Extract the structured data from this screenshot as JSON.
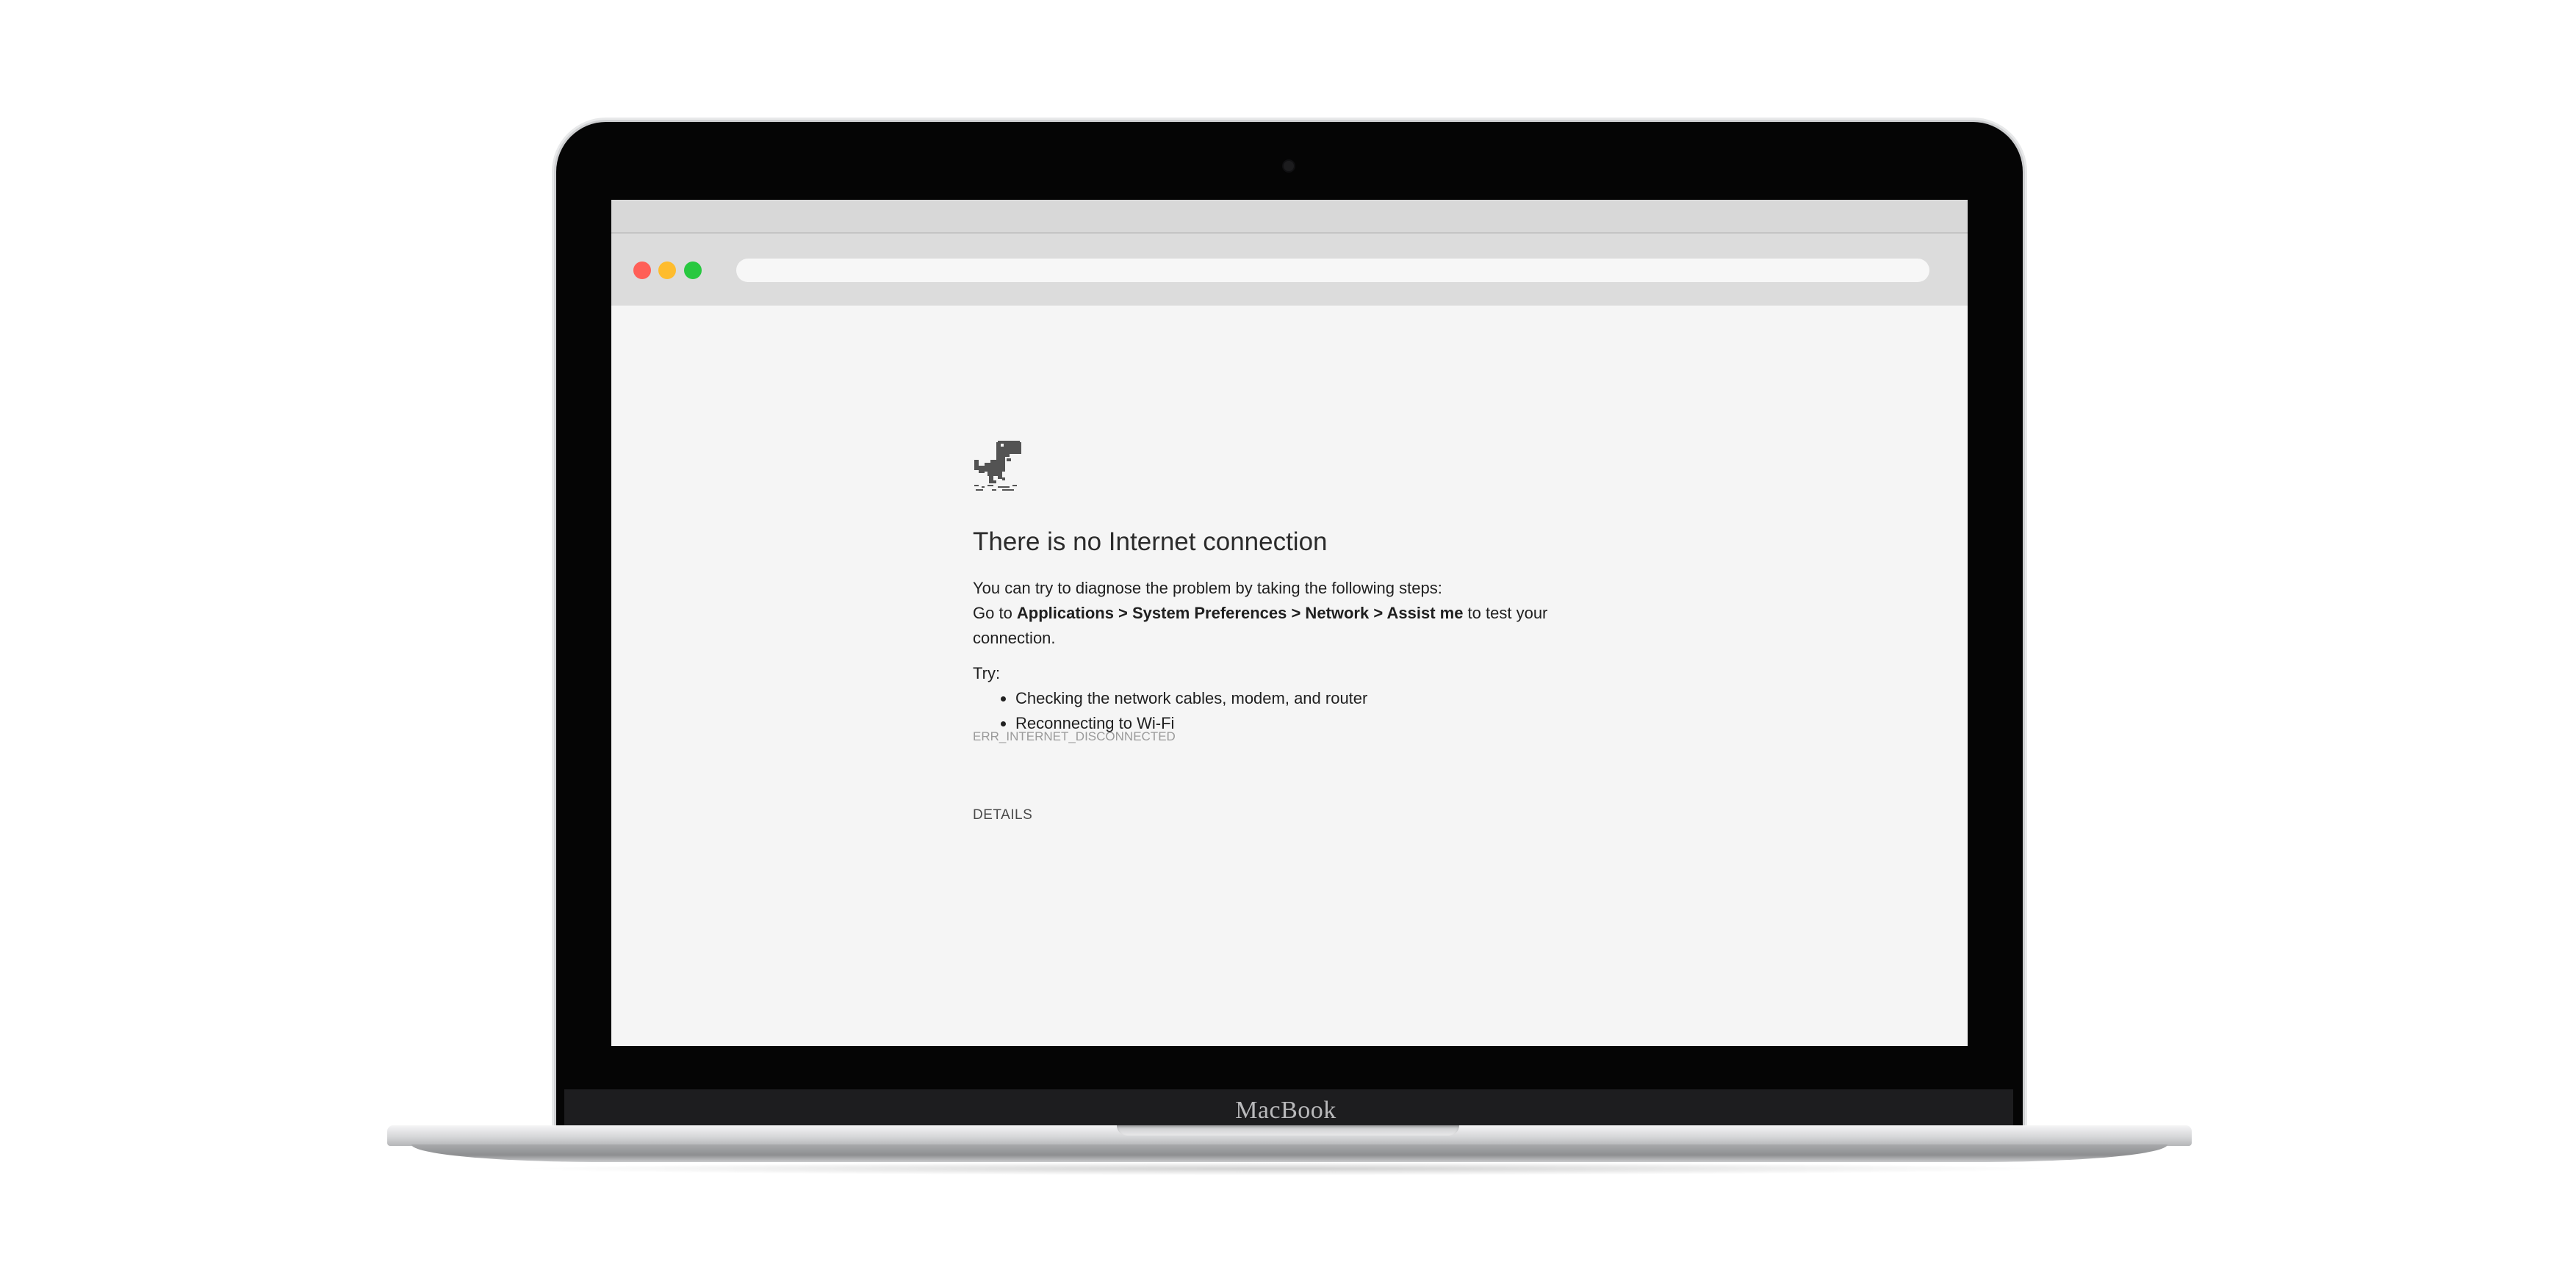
{
  "device": {
    "brand_label": "MacBook"
  },
  "browser": {
    "window_controls": [
      {
        "name": "close",
        "color": "#ff5f57"
      },
      {
        "name": "minimize",
        "color": "#febc2e"
      },
      {
        "name": "zoom",
        "color": "#28c840"
      }
    ],
    "address_bar": {
      "value": ""
    }
  },
  "error_page": {
    "icon": "offline-dinosaur-icon",
    "heading": "There is no Internet connection",
    "intro": "You can try to diagnose the problem by taking the following steps:",
    "steps_prefix": "Go to ",
    "steps_path": "Applications > System Preferences > Network > Assist me",
    "steps_suffix": " to test your connection.",
    "try_label": "Try:",
    "suggestions": [
      "Checking the network cables, modem, and router",
      "Reconnecting to Wi-Fi"
    ],
    "error_code": "ERR_INTERNET_DISCONNECTED",
    "details_button": "DETAILS"
  }
}
